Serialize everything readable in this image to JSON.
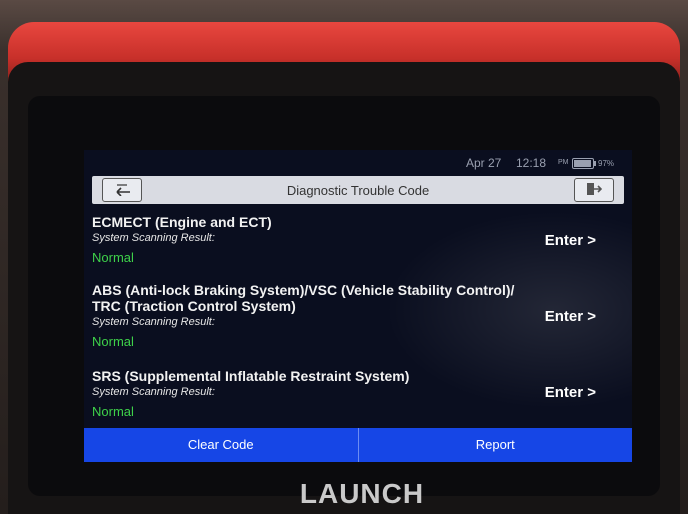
{
  "status": {
    "date": "Apr 27",
    "time": "12:18",
    "ampm": "PM",
    "battery": "97%",
    "battery_level": 0.97
  },
  "header": {
    "title": "Diagnostic Trouble Code"
  },
  "systems": [
    {
      "name_line1": "ECMECT (Engine and ECT)",
      "name_line2": "",
      "scan_label": "System Scanning Result:",
      "status": "Normal",
      "enter": "Enter >"
    },
    {
      "name_line1": "ABS (Anti-lock Braking System)/VSC (Vehicle Stability Control)/",
      "name_line2": "TRC (Traction Control System)",
      "scan_label": "System Scanning Result:",
      "status": "Normal",
      "enter": "Enter >"
    },
    {
      "name_line1": "SRS (Supplemental Inflatable Restraint System)",
      "name_line2": "",
      "scan_label": "System Scanning Result:",
      "status": "Normal",
      "enter": "Enter >"
    }
  ],
  "footer": {
    "clear": "Clear Code",
    "report": "Report"
  },
  "device": {
    "brand": "LAUNCH"
  },
  "colors": {
    "accent": "#1646e6",
    "ok": "#3ed14a",
    "device_red": "#c8302a"
  },
  "icons": {
    "back": "back-arrow-icon",
    "exit": "exit-icon",
    "battery": "battery-icon"
  }
}
